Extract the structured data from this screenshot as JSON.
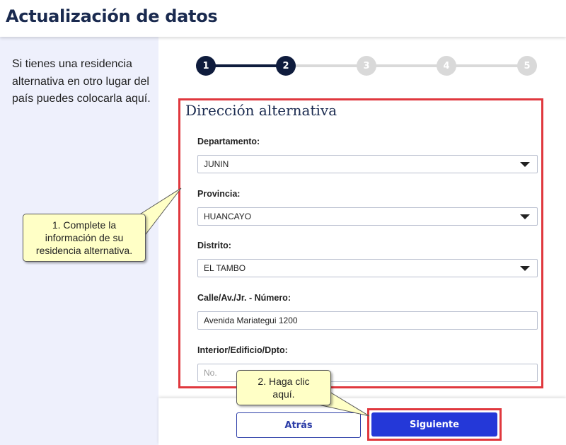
{
  "header": {
    "title": "Actualización de datos"
  },
  "sidebar": {
    "text": "Si tienes una residencia alternativa en otro lugar del país puedes colocarla aquí."
  },
  "stepper": {
    "steps": [
      {
        "label": "1",
        "state": "completed"
      },
      {
        "label": "2",
        "state": "active"
      },
      {
        "label": "3",
        "state": "pending"
      },
      {
        "label": "4",
        "state": "pending"
      },
      {
        "label": "5",
        "state": "pending"
      }
    ]
  },
  "form": {
    "title": "Dirección alternativa",
    "departamento": {
      "label": "Departamento:",
      "value": "JUNIN"
    },
    "provincia": {
      "label": "Provincia:",
      "value": "HUANCAYO"
    },
    "distrito": {
      "label": "Distrito:",
      "value": "EL TAMBO"
    },
    "calle": {
      "label": "Calle/Av./Jr. - Número:",
      "value": "Avenida Mariategui 1200"
    },
    "interior": {
      "label": "Interior/Edificio/Dpto:",
      "placeholder": "No."
    }
  },
  "footer": {
    "back_label": "Atrás",
    "next_label": "Siguiente"
  },
  "callouts": {
    "first": "1. Complete la información de su residencia alternativa.",
    "second": "2. Haga clic aquí."
  },
  "colors": {
    "primary": "#2438d8",
    "dark_navy": "#0f1c3d",
    "highlight": "#e0383e",
    "callout": "#ffffc6"
  }
}
